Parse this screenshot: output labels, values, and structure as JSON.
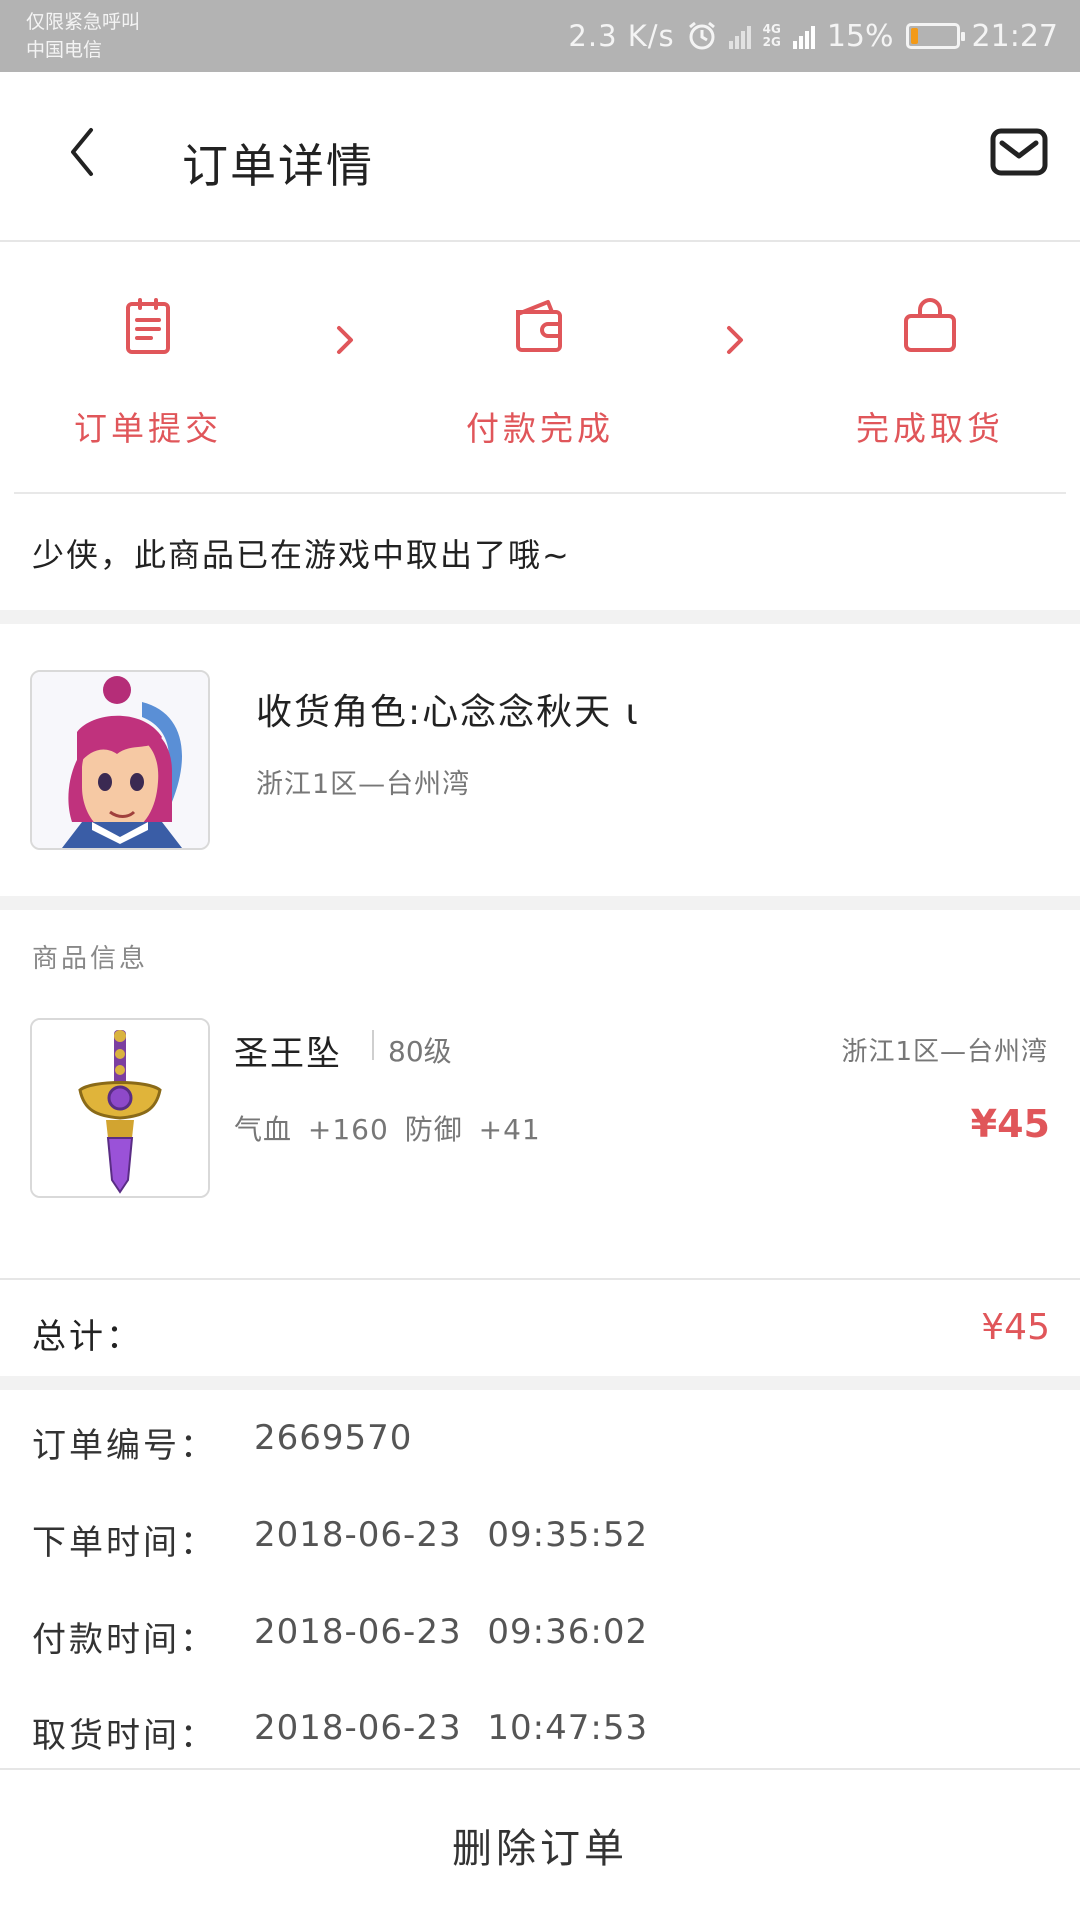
{
  "status_bar": {
    "line1": "仅限紧急呼叫",
    "line2": "中国电信",
    "net_speed": "2.3 K/s",
    "net_type_top": "4G",
    "net_type_bottom": "2G",
    "battery_text": "15%",
    "battery_level": 0.15,
    "time": "21:27"
  },
  "header": {
    "title": "订单详情",
    "back_icon": "chevron-left-icon",
    "mail_icon": "mail-icon"
  },
  "steps": [
    {
      "label": "订单提交",
      "icon": "clipboard-icon"
    },
    {
      "label": "付款完成",
      "icon": "wallet-icon"
    },
    {
      "label": "完成取货",
      "icon": "shopping-bag-icon"
    }
  ],
  "notice": "少侠，此商品已在游戏中取出了哦~",
  "receiver": {
    "role": "收货角色:心念念秋天 ι",
    "server": "浙江1区—台州湾"
  },
  "product_section": {
    "title": "商品信息",
    "item": {
      "name": "圣王坠",
      "level": "80级",
      "server": "浙江1区—台州湾",
      "stats": "气血 +160 防御 +41",
      "price": "¥45"
    }
  },
  "total": {
    "label": "总计：",
    "value": "¥45"
  },
  "order_info": [
    {
      "label": "订单编号：",
      "value": "2669570"
    },
    {
      "label": "下单时间：",
      "value": "2018-06-23 09:35:52"
    },
    {
      "label": "付款时间：",
      "value": "2018-06-23 09:36:02"
    },
    {
      "label": "取货时间：",
      "value": "2018-06-23 10:47:53"
    }
  ],
  "delete_button": "删除订单",
  "colors": {
    "accent": "#e0565a",
    "status_bar": "#b3b3b3",
    "battery_fill": "#f39a18"
  }
}
